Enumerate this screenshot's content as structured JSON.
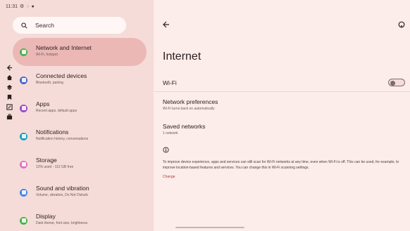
{
  "status_bar": {
    "time": "11:31"
  },
  "search": {
    "label": "Search"
  },
  "menu": [
    {
      "title": "Network and Internet",
      "sub": "Wi-Fi, hotspot",
      "color": "#4caf50",
      "selected": true
    },
    {
      "title": "Connected devices",
      "sub": "Bluetooth, pairing",
      "color": "#4a66c9"
    },
    {
      "title": "Apps",
      "sub": "Recent apps, default apps",
      "color": "#9c48c4"
    },
    {
      "title": "Notifications",
      "sub": "Notification history, conversations",
      "color": "#14a1c0"
    },
    {
      "title": "Storage",
      "sub": "12% used - 112 GB free",
      "color": "#e36dc8"
    },
    {
      "title": "Sound and vibration",
      "sub": "Volume, vibration, Do Not Disturb",
      "color": "#3f83ea"
    },
    {
      "title": "Display",
      "sub": "Dark theme, font size, brightness",
      "color": "#45b649"
    }
  ],
  "main": {
    "title": "Internet",
    "wifi_label": "Wi-Fi",
    "wifi_on": false,
    "network_prefs": {
      "title": "Network preferences",
      "sub": "Wi-Fi turns back on automatically"
    },
    "saved_networks": {
      "title": "Saved networks",
      "sub": "1 network"
    },
    "info_text": "To improve device experience, apps and services can still scan for Wi-Fi networks at any time, even when Wi-Fi is off. This can be used, for example, to improve location-based features and services. You can change this in Wi-Fi scanning settings.",
    "change_label": "Change"
  },
  "colors": {
    "accent": "#a4403c",
    "selected_bg": "#ebb8b6"
  }
}
